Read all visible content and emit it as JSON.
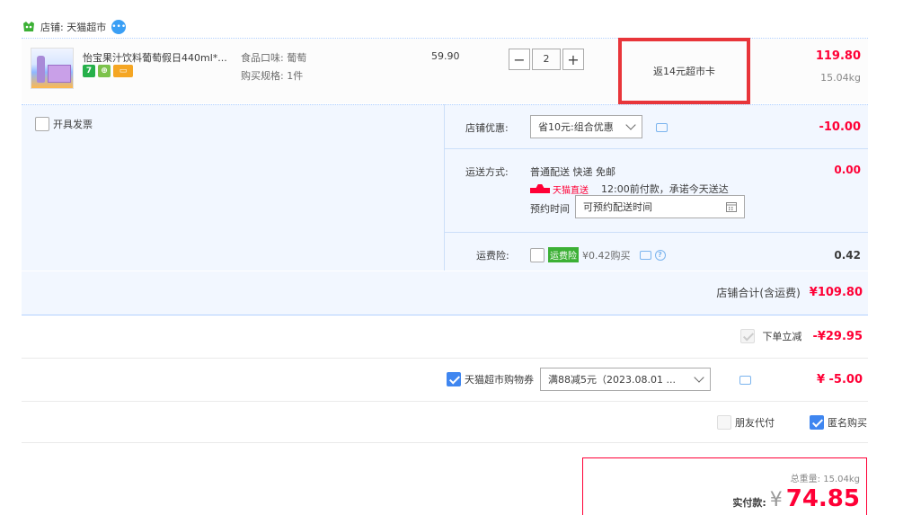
{
  "store": {
    "label": "店铺: 天猫超市"
  },
  "item": {
    "title": "怡宝果汁饮料葡萄假日440ml*...",
    "sku_flavor": "食品口味: 葡萄",
    "sku_spec": "购买规格: 1件",
    "unit_price": "59.90",
    "quantity": "2",
    "promo": "返14元超市卡",
    "subtotal": "119.80",
    "weight": "15.04kg"
  },
  "options": {
    "invoice_label": "开具发票",
    "discount_label": "店铺优惠:",
    "discount_select": "省10元:组合优惠",
    "discount_amount": "-10.00",
    "shipping_label": "运送方式:",
    "shipping_method": "普通配送 快递 免邮",
    "shipping_fee": "0.00",
    "tmall_direct": "天猫直送",
    "delivery_promise": "12:00前付款，承诺今天送达",
    "appointment_label": "预约时间",
    "appointment_value": "可预约配送时间",
    "insurance_label": "运费险:",
    "insurance_tag": "运费险",
    "insurance_price": "¥0.42购买",
    "insurance_amount": "0.42"
  },
  "store_total": {
    "label": "店铺合计(含运费)",
    "amount": "¥109.80"
  },
  "order_discount": {
    "label": "下单立减",
    "amount": "-¥29.95"
  },
  "coupon": {
    "label": "天猫超市购物券",
    "select": "满88减5元（2023.08.01 ...",
    "amount": "¥ -5.00"
  },
  "extra": {
    "friend_pay": "朋友代付",
    "anonymous": "匿名购买"
  },
  "payment": {
    "total_weight": "总重量: 15.04kg",
    "actual_label": "实付款:",
    "currency": "¥",
    "amount": "74.85"
  },
  "colors": {
    "accent_red": "#ff0036",
    "promo_border": "#e8353a",
    "panel_bg": "#f2f7ff",
    "check_blue": "#3f86f0"
  }
}
